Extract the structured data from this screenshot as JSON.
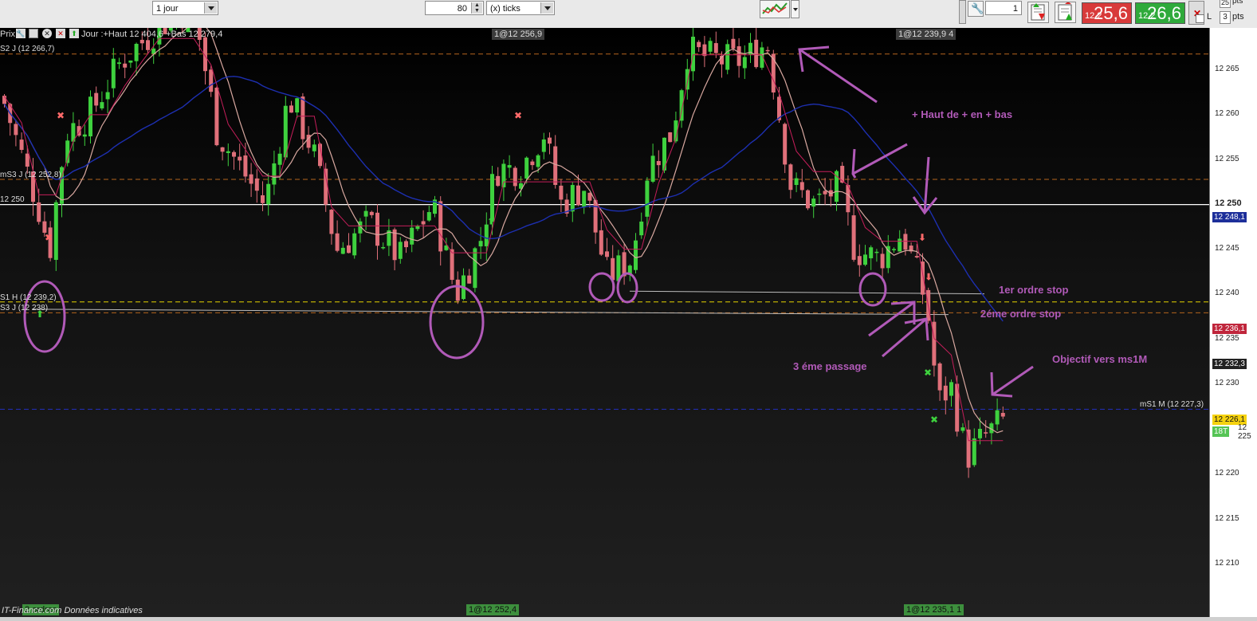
{
  "toolbar": {
    "timeframe": "1 jour",
    "units_value": "80",
    "units_label": "(x) ticks",
    "quantity": "1",
    "sell_small": "12 2",
    "sell_big": "25,6",
    "buy_small": "12 2",
    "buy_big": "26,6",
    "check_l": "L",
    "pts_value": "3",
    "pts_label": "pts",
    "pts_top": "25",
    "pts_top_label": "pts"
  },
  "chart_header": {
    "prix": "Prix",
    "title": "Jour :+Haut 12 404,6 +Bas 12 279,4",
    "top_tag_1": "1@12 256,9",
    "top_tag_2": "1@12 239,9 4"
  },
  "levels": [
    {
      "label": "S2 J (12 266,7)",
      "price": 12266.7,
      "color": "#b5651d",
      "style": "dashed"
    },
    {
      "label": "mS3 J (12 252,8)",
      "price": 12252.8,
      "color": "#b5651d",
      "style": "dashed"
    },
    {
      "label": "12 250",
      "price": 12250,
      "color": "#ffffff",
      "style": "solid"
    },
    {
      "label": "S1 H (12 239,2)",
      "price": 12239.2,
      "color": "#e6d300",
      "style": "dashed"
    },
    {
      "label": "S3 J (12 238)",
      "price": 12238,
      "color": "#b5651d",
      "style": "dashed"
    },
    {
      "label": "mS1 M (12 227,3)",
      "price": 12227.3,
      "color": "#2430c0",
      "style": "dashed"
    }
  ],
  "axis": {
    "ticks": [
      "12 265",
      "12 260",
      "12 255",
      "12 250",
      "12 245",
      "12 240",
      "12 235",
      "12 230",
      "12 225",
      "12 220",
      "12 215",
      "12 210"
    ],
    "bold_tick": "12 250",
    "tag_blue": "12 248,1",
    "tag_red": "12 236,1",
    "tag_dark": "12 232,3",
    "tag_yellow": "12 226,1",
    "tag_green": "18T",
    "tag_yellow_color": "#f5d20f",
    "tag_red_color": "#c0263c",
    "tag_green_color": "#55c455"
  },
  "annotations": {
    "a1": "+ Haut de + en + bas",
    "a2": "1er ordre stop",
    "a3": "2éme ordre stop",
    "a4": "3 éme passage",
    "a5": "Objectif vers ms1M",
    "color": "#b15ab8"
  },
  "footer": {
    "left": "IT-Finance.com  Données indicatives",
    "left_tag": "2 ordres",
    "mid_tag": "1@12 252,4",
    "right_tag": "1@12 235,1 1"
  },
  "chart_data": {
    "type": "candlestick",
    "title": "",
    "y_range": [
      12206,
      12272
    ],
    "series": [
      {
        "name": "",
        "kind": "candles"
      }
    ]
  }
}
